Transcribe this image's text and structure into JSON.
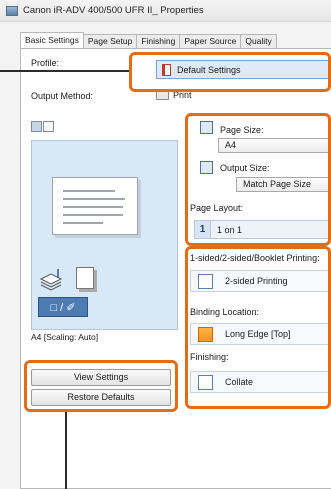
{
  "window": {
    "title": "Canon iR-ADV 400/500 UFR II_ Properties"
  },
  "tabs": [
    {
      "label": "Basic Settings"
    },
    {
      "label": "Page Setup"
    },
    {
      "label": "Finishing"
    },
    {
      "label": "Paper Source"
    },
    {
      "label": "Quality"
    }
  ],
  "profile": {
    "label": "Profile:",
    "value": "Default Settings"
  },
  "output_method": {
    "label": "Output Method:",
    "value": "Print"
  },
  "preview": {
    "caption": "A4 [Scaling: Auto]",
    "mode_glyph": "□ / ✐"
  },
  "buttons": {
    "view_settings": "View Settings",
    "restore_defaults": "Restore Defaults"
  },
  "page_size": {
    "label": "Page Size:",
    "value": "A4"
  },
  "output_size": {
    "label": "Output Size:",
    "value": "Match Page Size"
  },
  "page_layout": {
    "label": "Page Layout:",
    "number": "1",
    "value": "1 on 1"
  },
  "printing": {
    "label": "1-sided/2-sided/Booklet Printing:",
    "value": "2-sided Printing"
  },
  "binding": {
    "label": "Binding Location:",
    "value": "Long Edge [Top]"
  },
  "finishing": {
    "label": "Finishing:",
    "value": "Collate"
  },
  "colors": {
    "highlight": "#e36d17",
    "preview_bg": "#d9e8f6"
  }
}
